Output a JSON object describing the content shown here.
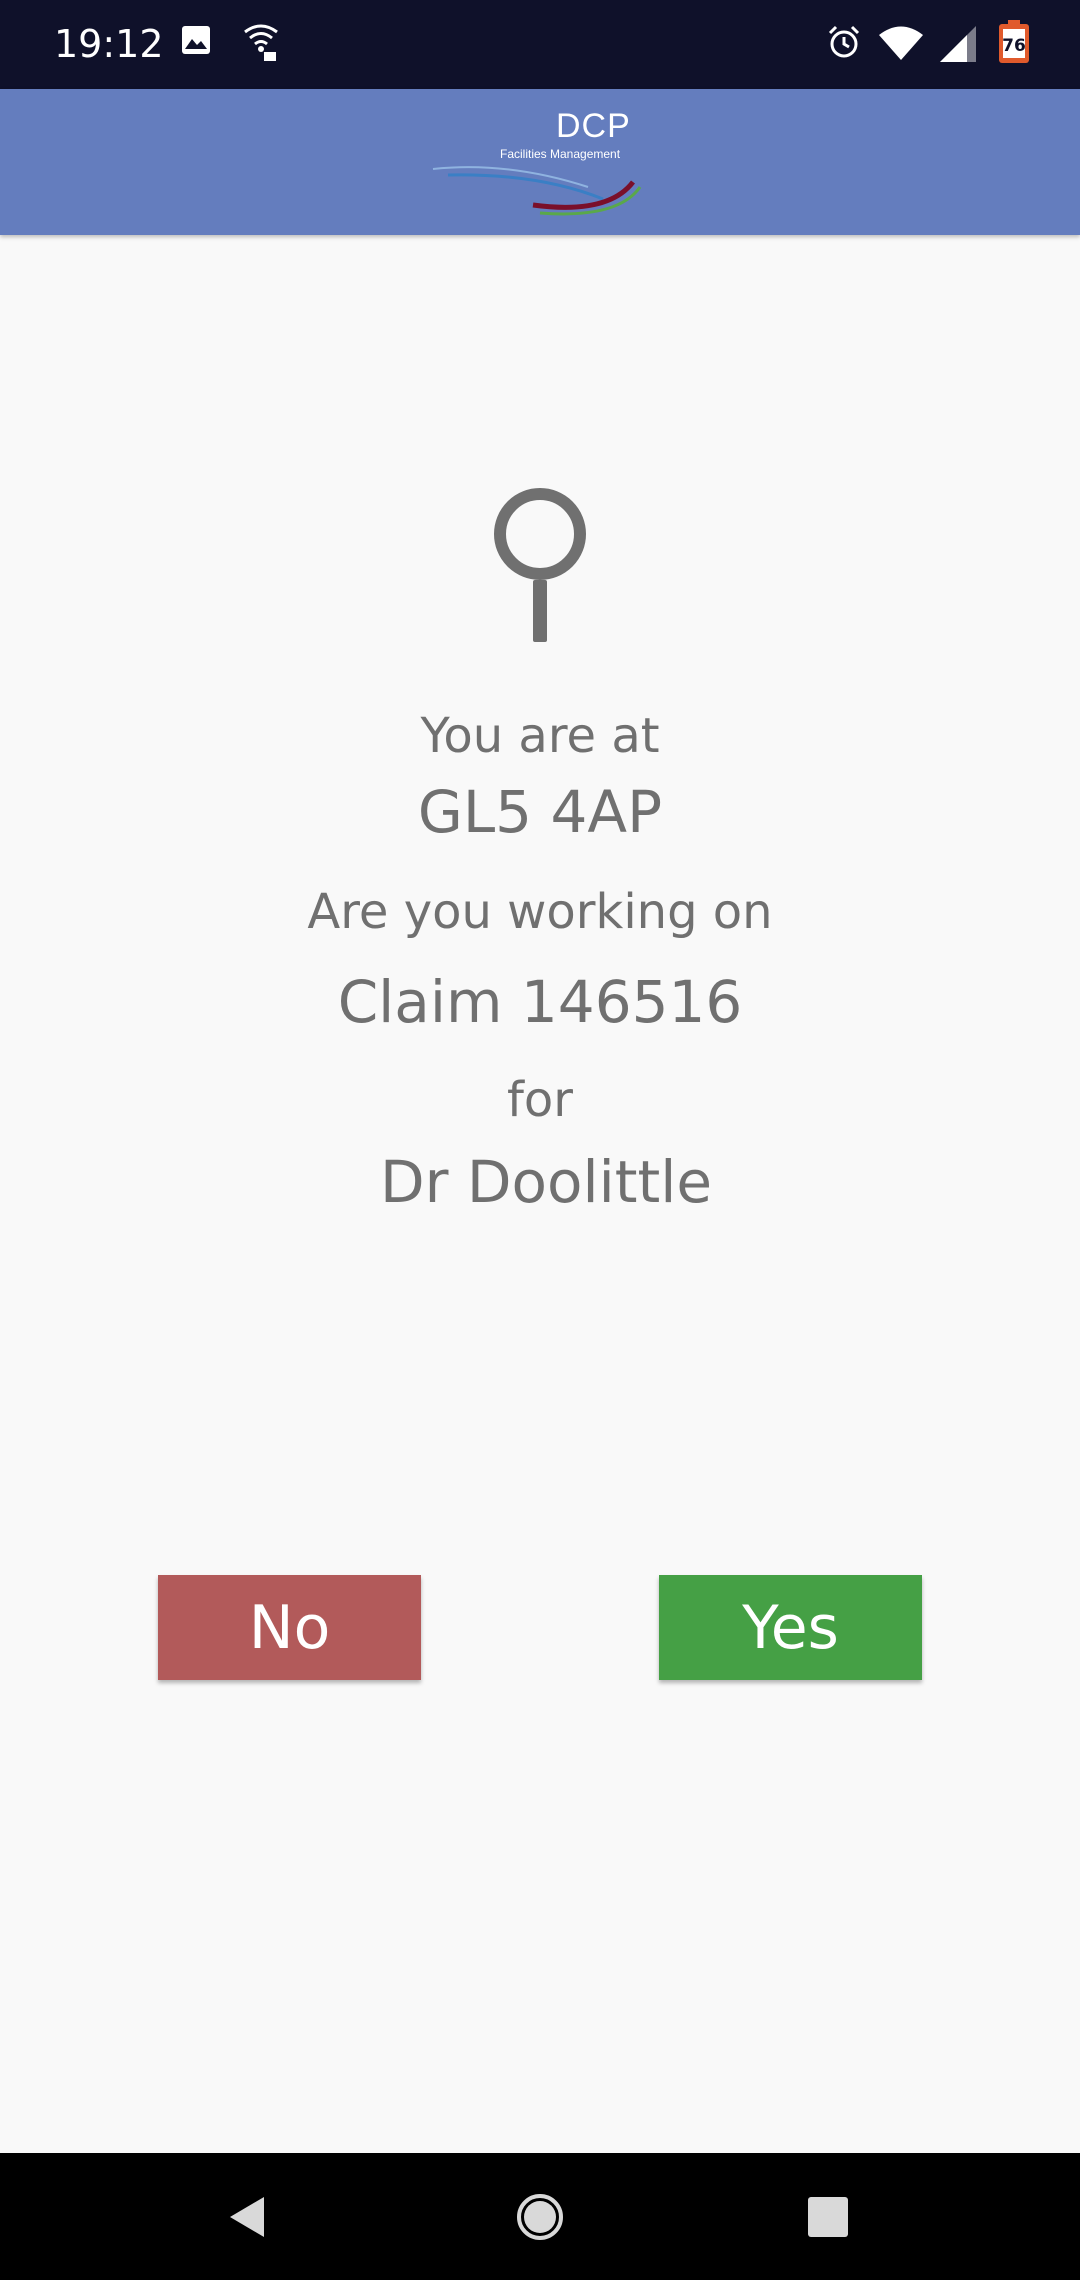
{
  "status_bar": {
    "time": "19:12",
    "battery_level": "76",
    "icons": [
      "image-icon",
      "wifi-calling-icon",
      "alarm-icon",
      "wifi-icon",
      "signal-icon",
      "battery-icon"
    ]
  },
  "app_bar": {
    "logo_title": "DCP",
    "logo_subtitle": "Facilities Management"
  },
  "main": {
    "location_label": "You are at",
    "location_value": "GL5 4AP",
    "question": "Are you working on",
    "claim": "Claim 146516",
    "for_label": "for",
    "client": "Dr Doolittle"
  },
  "buttons": {
    "no_label": "No",
    "yes_label": "Yes"
  },
  "colors": {
    "status_bar": "#0f112a",
    "app_bar": "#647dbe",
    "no_button": "#b25a5a",
    "yes_button": "#45a045",
    "text": "#707070"
  },
  "nav_bar": {
    "icons": [
      "back-icon",
      "home-icon",
      "recents-icon"
    ]
  }
}
